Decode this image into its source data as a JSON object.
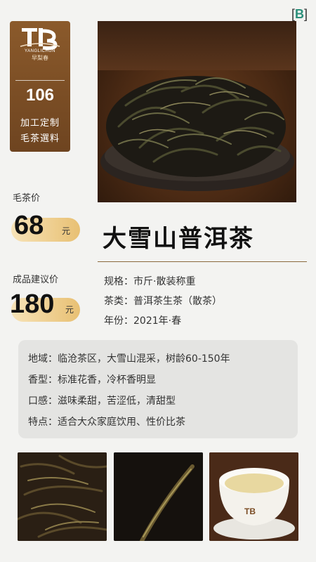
{
  "corner_badge": {
    "left": "[",
    "letter": "B",
    "right": "]"
  },
  "brand": {
    "logo_mark": "TB",
    "logo_en": "YANGLICHUN",
    "logo_script": "早梨春",
    "code": "106",
    "line1": "加工定制",
    "line2": "毛茶選料"
  },
  "prices": {
    "raw_label": "毛茶价",
    "raw_value": "68",
    "raw_unit": "元",
    "suggested_label": "成品建议价",
    "suggested_value": "180",
    "suggested_unit": "元"
  },
  "title": "大雪山普洱茶",
  "specs": [
    {
      "label": "规格：",
      "value": "市斤·散装称重"
    },
    {
      "label": "茶类：",
      "value": "普洱茶生茶（散茶）"
    },
    {
      "label": "年份：",
      "value": "2021年·春"
    }
  ],
  "info": [
    {
      "label": "地域：",
      "value": "临沧茶区，大雪山混采，树龄60-150年"
    },
    {
      "label": "香型：",
      "value": "标准花香，冷杯香明显"
    },
    {
      "label": "口感：",
      "value": "滋味柔甜，苦涩低，清甜型"
    },
    {
      "label": "特点：",
      "value": "适合大众家庭饮用、性价比茶"
    }
  ],
  "colors": {
    "brand": "#7a4c24",
    "price_pill_start": "#f7e3b8",
    "price_pill_end": "#e8c073",
    "accent_badge": "#2a8f7a"
  },
  "images": {
    "hero": "loose-leaf-tea-plate-photo",
    "thumb1": "dry-leaves-closeup-photo",
    "thumb2": "single-tea-leaf-photo",
    "thumb3": "tea-cup-photo"
  }
}
